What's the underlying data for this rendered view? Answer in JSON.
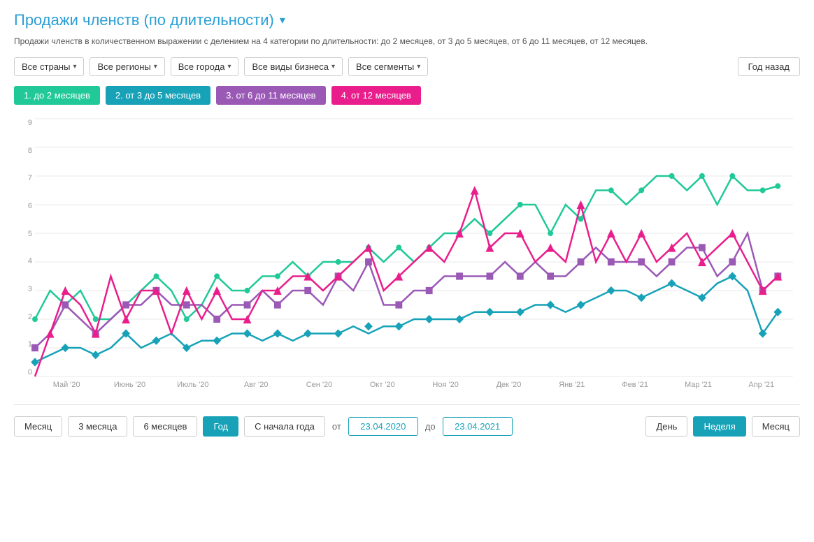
{
  "title": "Продажи членств (по длительности)",
  "subtitle": "Продажи членств в количественном выражении с делением на 4 категории по длительности: до 2 месяцев, от 3 до 5 месяцев, от 6 до 11 месяцев, от 12 месяцев.",
  "filters": {
    "country": "Все страны",
    "region": "Все регионы",
    "city": "Все города",
    "business": "Все виды бизнеса",
    "segment": "Все сегменты",
    "yearAgo": "Год назад"
  },
  "legend": [
    {
      "id": 1,
      "label": "1. до 2 месяцев",
      "color": "#20c997"
    },
    {
      "id": 2,
      "label": "2. от 3 до 5 месяцев",
      "color": "#17a2b8"
    },
    {
      "id": 3,
      "label": "3. от 6 до 11 месяцев",
      "color": "#9b59b6"
    },
    {
      "id": 4,
      "label": "4. от 12 месяцев",
      "color": "#e91e8c"
    }
  ],
  "yAxis": {
    "labels": [
      "0",
      "1",
      "2",
      "3",
      "4",
      "5",
      "6",
      "7",
      "8",
      "9"
    ]
  },
  "xAxis": {
    "labels": [
      "Май '20",
      "Июнь '20",
      "Июль '20",
      "Авг '20",
      "Сен '20",
      "Окт '20",
      "Ноя '20",
      "Дек '20",
      "Янв '21",
      "Фев '21",
      "Мар '21",
      "Апр '21"
    ]
  },
  "bottomBar": {
    "periods": [
      {
        "label": "Месяц",
        "active": false
      },
      {
        "label": "3 месяца",
        "active": false
      },
      {
        "label": "6 месяцев",
        "active": false
      },
      {
        "label": "Год",
        "active": true
      },
      {
        "label": "С начала года",
        "active": false
      }
    ],
    "fromLabel": "от",
    "toLabel": "до",
    "fromDate": "23.04.2020",
    "toDate": "23.04.2021",
    "views": [
      {
        "label": "День",
        "active": false
      },
      {
        "label": "Неделя",
        "active": true
      },
      {
        "label": "Месяц",
        "active": false
      }
    ]
  }
}
